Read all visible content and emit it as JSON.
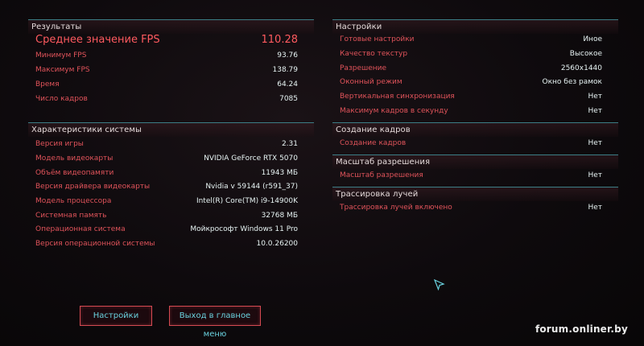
{
  "results": {
    "title": "Результаты",
    "rows": [
      {
        "label": "Среднее значение FPS",
        "value": "110.28"
      },
      {
        "label": "Минимум FPS",
        "value": "93.76"
      },
      {
        "label": "Максимум FPS",
        "value": "138.79"
      },
      {
        "label": "Время",
        "value": "64.24"
      },
      {
        "label": "Число кадров",
        "value": "7085"
      }
    ]
  },
  "system": {
    "title": "Характеристики системы",
    "rows": [
      {
        "label": "Версия игры",
        "value": "2.31"
      },
      {
        "label": "Модель видеокарты",
        "value": "NVIDIA GeForce RTX 5070"
      },
      {
        "label": "Объём видеопамяти",
        "value": "11943 МБ"
      },
      {
        "label": "Версия драйвера видеокарты",
        "value": "Nvidia v 59144 (r591_37)"
      },
      {
        "label": "Модель процессора",
        "value": "Intel(R) Core(TM) i9-14900K"
      },
      {
        "label": "Системная память",
        "value": "32768 МБ"
      },
      {
        "label": "Операционная система",
        "value": "Мойкрософт Windows 11 Pro"
      },
      {
        "label": "Версия операционной системы",
        "value": "10.0.26200"
      }
    ]
  },
  "settings": {
    "title": "Настройки",
    "rows": [
      {
        "label": "Готовые настройки",
        "value": "Иное"
      },
      {
        "label": "Качество текстур",
        "value": "Высокое"
      },
      {
        "label": "Разрешение",
        "value": "2560x1440"
      },
      {
        "label": "Оконный режим",
        "value": "Окно без рамок"
      },
      {
        "label": "Вертикальная синхронизация",
        "value": "Нет"
      },
      {
        "label": "Максимум кадров в секунду",
        "value": "Нет"
      }
    ]
  },
  "frame_gen": {
    "title": "Создание кадров",
    "rows": [
      {
        "label": "Создание кадров",
        "value": "Нет"
      }
    ]
  },
  "res_scaling": {
    "title": "Масштаб разрешения",
    "rows": [
      {
        "label": "Масштаб разрешения",
        "value": "Нет"
      }
    ]
  },
  "ray_tracing": {
    "title": "Трассировка лучей",
    "rows": [
      {
        "label": "Трассировка лучей включено",
        "value": "Нет"
      }
    ]
  },
  "buttons": {
    "settings": "Настройки",
    "main_menu": "Выход в главное меню"
  },
  "watermark": "forum.onliner.by",
  "colors": {
    "label_red": "#e0535a",
    "value_white": "#e7f3f3",
    "divider_teal": "#3c7e86",
    "button_border": "#d54a52",
    "button_text": "#6ad2df"
  },
  "icons": [
    "cursor-arrow-icon"
  ]
}
